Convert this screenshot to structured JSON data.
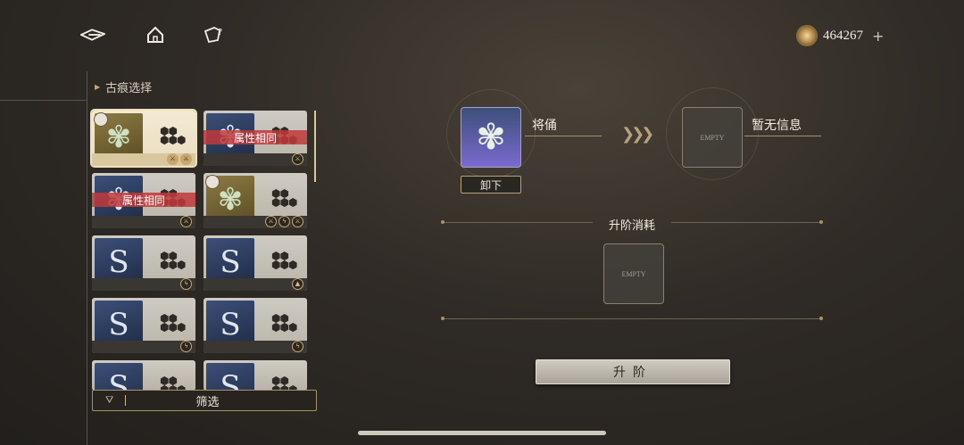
{
  "topbar": {
    "back_icon": "back-arrow-icon",
    "home_icon": "home-icon",
    "help_icon": "help-icon",
    "currency": {
      "amount": "464267",
      "plus": "+"
    }
  },
  "panel": {
    "title": "古痕选择",
    "cards": [
      {
        "banner": "",
        "style": "selected",
        "badges": [
          "⚔",
          "⚔"
        ],
        "avatar": true
      },
      {
        "banner": "属性相同",
        "style": "blue",
        "badges": [
          "⚔"
        ],
        "avatar": false
      },
      {
        "banner": "属性相同",
        "style": "blue",
        "badges": [
          "⚔"
        ],
        "avatar": false
      },
      {
        "banner": "",
        "style": "gold",
        "badges": [
          "⚔",
          "ϟ",
          "⚔"
        ],
        "avatar": true
      },
      {
        "banner": "",
        "style": "blue",
        "badges": [
          "ϟ"
        ],
        "avatar": false
      },
      {
        "banner": "",
        "style": "blue",
        "badges": [
          "▲"
        ],
        "avatar": false
      },
      {
        "banner": "",
        "style": "blue",
        "badges": [
          "ϟ"
        ],
        "avatar": false
      },
      {
        "banner": "",
        "style": "blue",
        "badges": [
          "ϟ"
        ],
        "avatar": false
      },
      {
        "banner": "",
        "style": "blue",
        "badges": [],
        "avatar": false
      },
      {
        "banner": "",
        "style": "blue",
        "badges": [],
        "avatar": false
      }
    ],
    "filter_label": "筛选"
  },
  "upgrade": {
    "current_label": "将俑",
    "unequip_label": "卸下",
    "result_label": "暂无信息",
    "empty_text": "EMPTY",
    "cost_title": "升阶消耗",
    "button_label": "升阶"
  }
}
